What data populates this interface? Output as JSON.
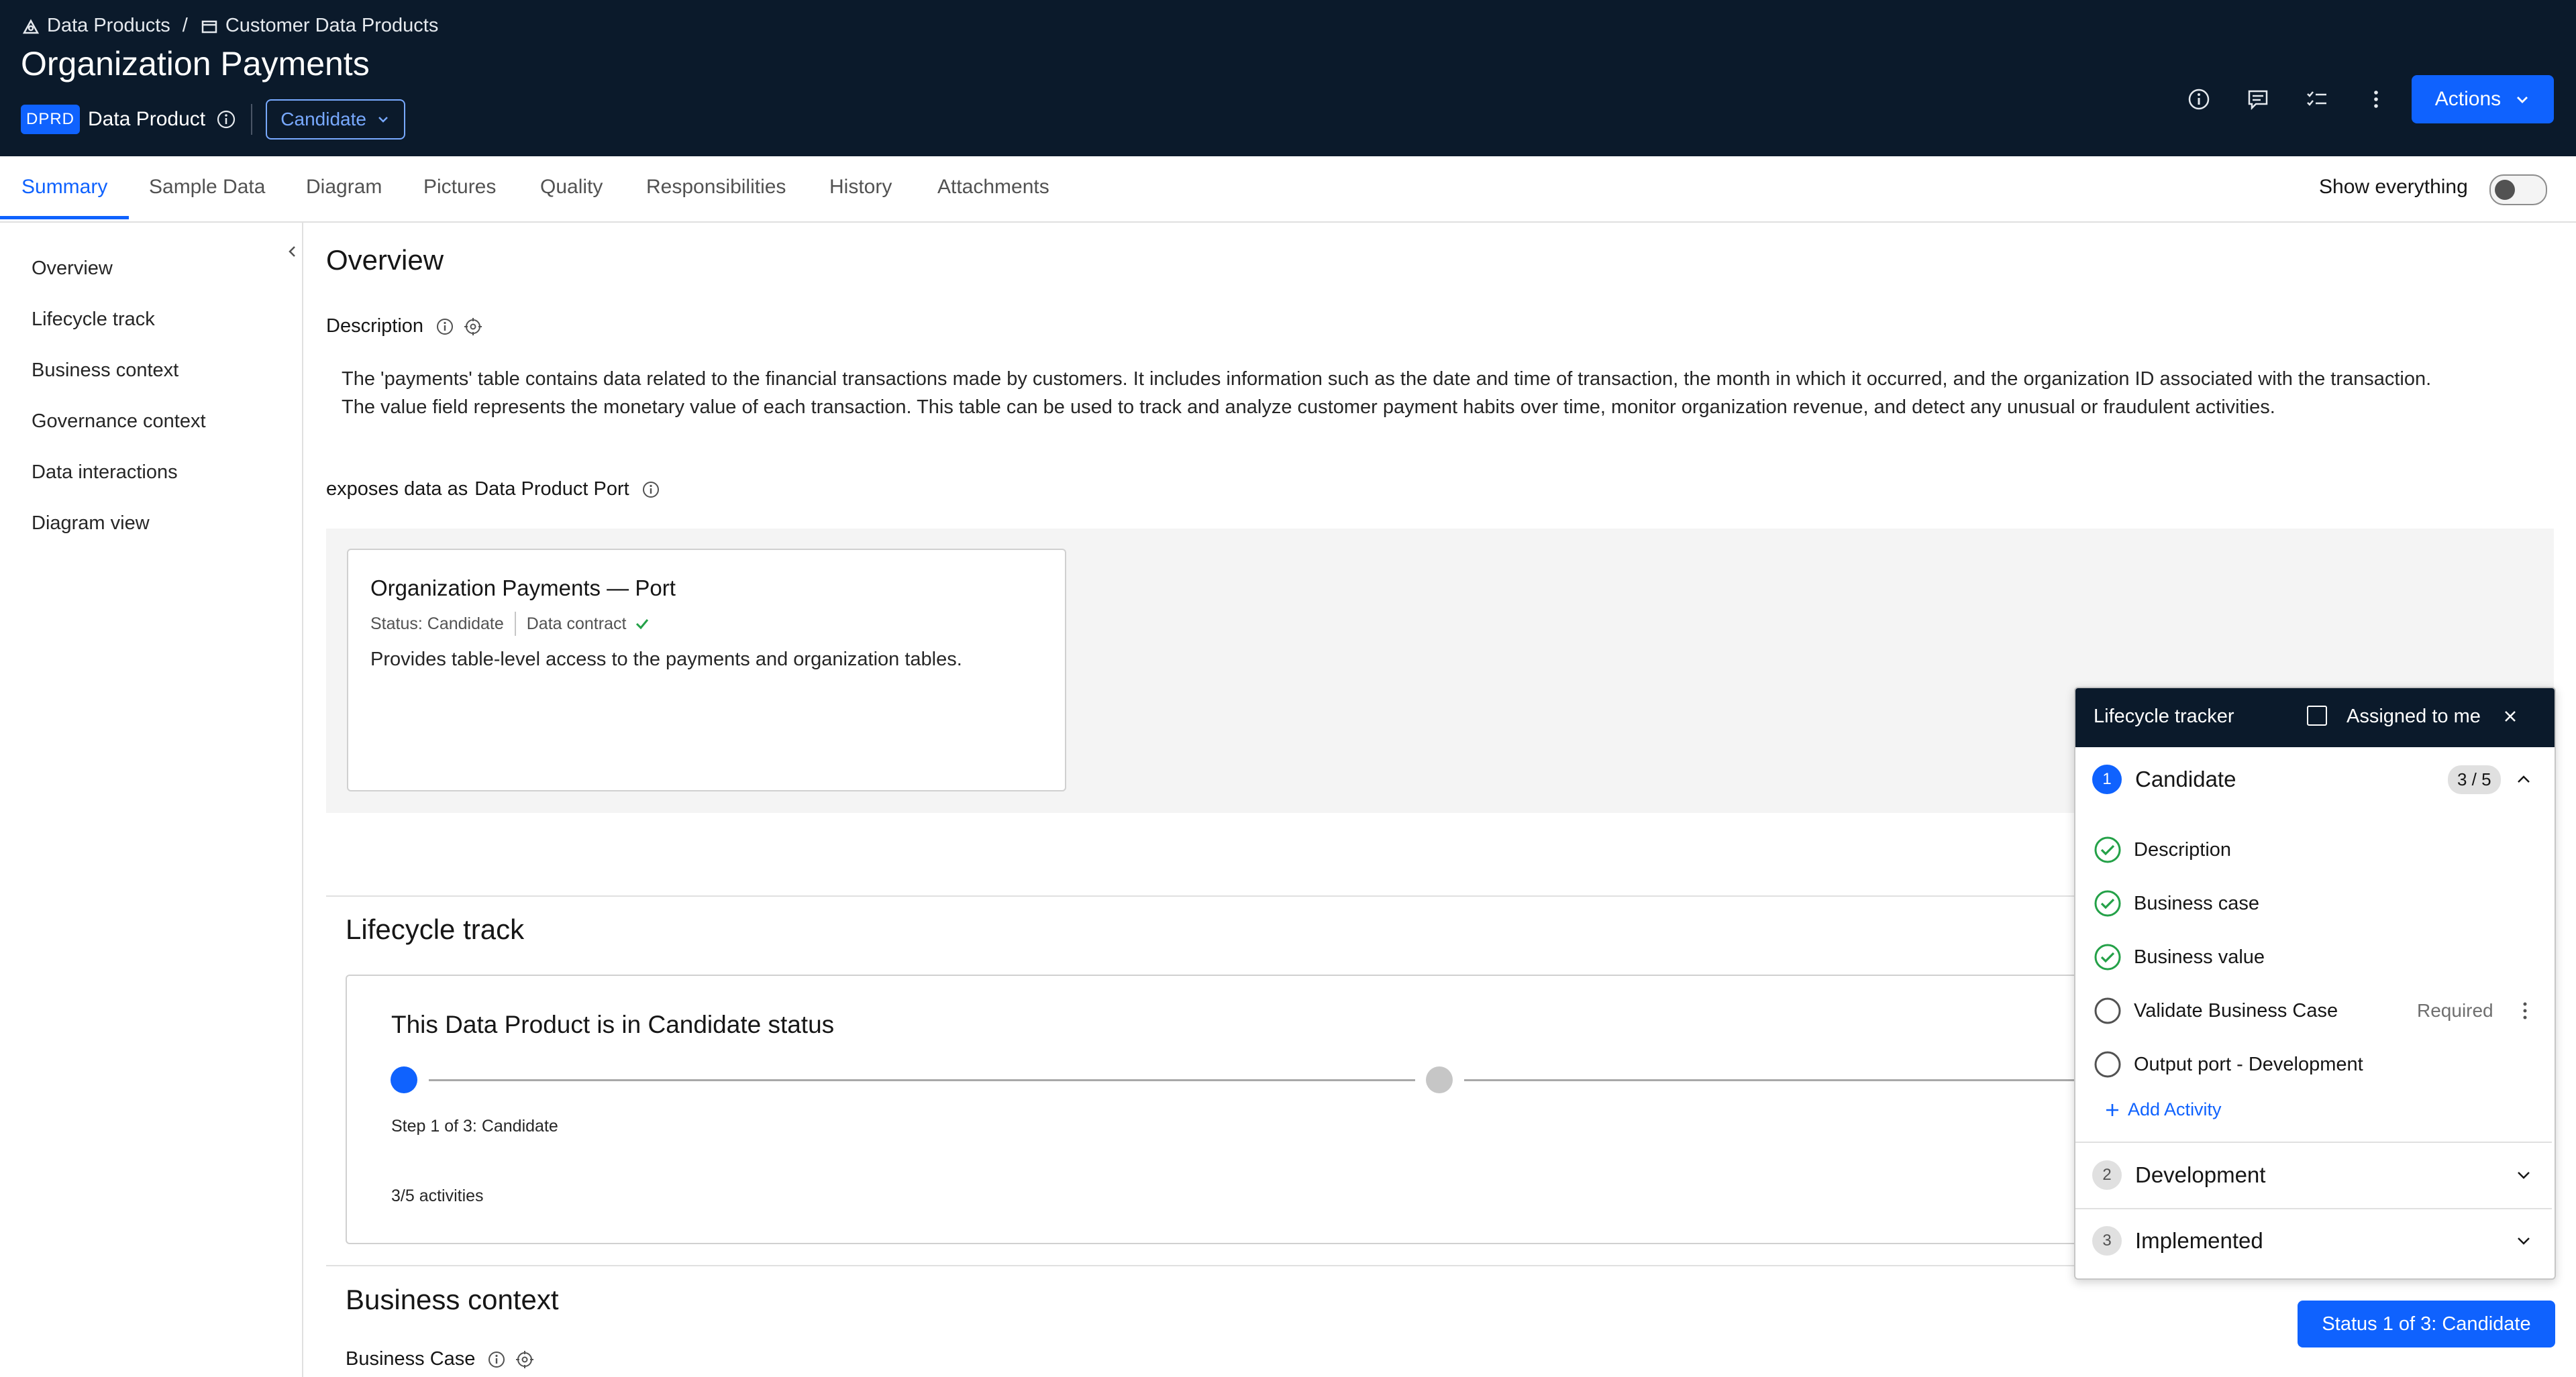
{
  "breadcrumb": {
    "item1": "Data Products",
    "separator": "/",
    "item2": "Customer Data Products"
  },
  "page_title": "Organization Payments",
  "type_badge": "DPRD",
  "type_label": "Data Product",
  "status_dropdown": "Candidate",
  "actions_button": "Actions",
  "tabs": [
    "Summary",
    "Sample Data",
    "Diagram",
    "Pictures",
    "Quality",
    "Responsibilities",
    "History",
    "Attachments"
  ],
  "show_everything_label": "Show everything",
  "side_nav": [
    "Overview",
    "Lifecycle track",
    "Business context",
    "Governance context",
    "Data interactions",
    "Diagram view"
  ],
  "overview": {
    "title": "Overview",
    "description_label": "Description",
    "description_line1": "The 'payments' table contains data related to the financial transactions made by customers. It includes information such as the date and time of transaction, the month in which it occurred, and the organization ID associated with the transaction.",
    "description_line2": "The value field represents the monetary value of each transaction. This table can be used to track and analyze customer payment habits over time, monitor organization revenue, and detect any unusual or fraudulent activities.",
    "exposes_prefix": "exposes data as",
    "exposes_type": "Data Product Port"
  },
  "port_card": {
    "title": "Organization Payments — Port",
    "status": "Status: Candidate",
    "contract": "Data contract",
    "description": "Provides table-level access to the payments and organization tables."
  },
  "lifecycle_track": {
    "title": "Lifecycle track",
    "card_title": "This Data Product is in Candidate status",
    "step_text": "Step 1 of 3: Candidate",
    "activities": "3/5 activities"
  },
  "business_context": {
    "title": "Business context",
    "business_case_label": "Business Case"
  },
  "tracker": {
    "title": "Lifecycle tracker",
    "assigned_label": "Assigned to me",
    "stages": [
      {
        "num": "1",
        "name": "Candidate",
        "count": "3 / 5"
      },
      {
        "num": "2",
        "name": "Development"
      },
      {
        "num": "3",
        "name": "Implemented"
      }
    ],
    "activities": [
      {
        "label": "Description",
        "done": true
      },
      {
        "label": "Business case",
        "done": true
      },
      {
        "label": "Business value",
        "done": true
      },
      {
        "label": "Validate Business Case",
        "done": false,
        "tag": "Required"
      },
      {
        "label": "Output port - Development",
        "done": false
      }
    ],
    "add_activity": "Add Activity"
  },
  "status_button": "Status 1 of 3: Candidate",
  "colors": {
    "header_bg": "#0b1a2b",
    "accent": "#0f62fe",
    "success": "#24a148",
    "badge_bg": "#0f62fe"
  }
}
